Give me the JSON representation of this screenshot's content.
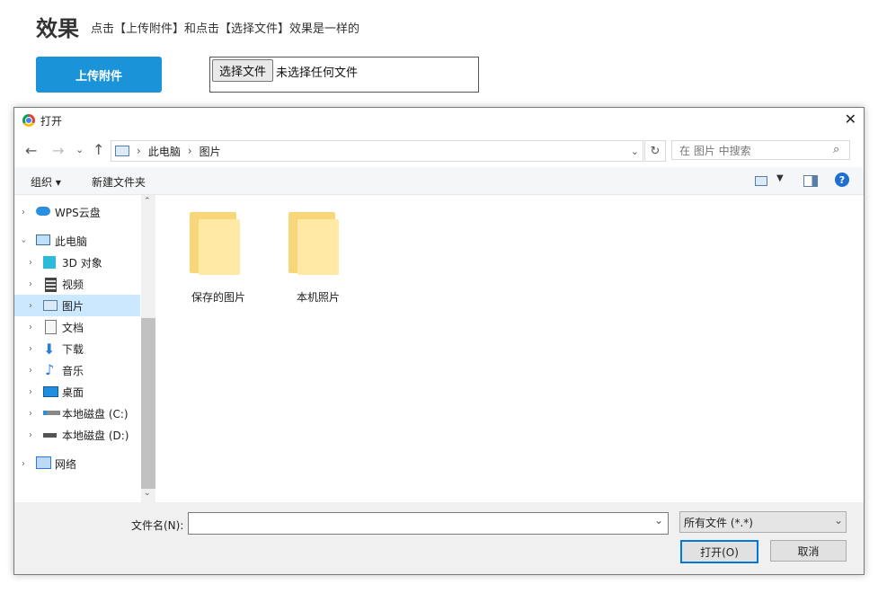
{
  "page": {
    "title": "效果",
    "subtitle": "点击【上传附件】和点击【选择文件】效果是一样的",
    "upload_button": "上传附件",
    "choose_file_button": "选择文件",
    "no_file_text": "未选择任何文件"
  },
  "dialog": {
    "title": "打开",
    "close_glyph": "✕",
    "breadcrumb": [
      "此电脑",
      "图片"
    ],
    "breadcrumb_sep": "›",
    "search_placeholder": "在 图片 中搜索",
    "toolbar": {
      "organize": "组织 ▾",
      "new_folder": "新建文件夹"
    },
    "nav": {
      "wps": "WPS云盘",
      "this_pc": "此电脑",
      "objects3d": "3D 对象",
      "video": "视频",
      "pictures": "图片",
      "documents": "文档",
      "downloads": "下载",
      "music": "音乐",
      "desktop": "桌面",
      "disk_c": "本地磁盘 (C:)",
      "disk_d": "本地磁盘 (D:)",
      "network": "网络"
    },
    "folders": [
      "保存的图片",
      "本机照片"
    ],
    "filename_label": "文件名(N):",
    "filename_value": "",
    "filetype": "所有文件 (*.*)",
    "open_button": "打开(O)",
    "cancel_button": "取消"
  },
  "colors": {
    "accent": "#1a93d9",
    "selection": "#cce8ff",
    "folder": "#f7d779"
  }
}
